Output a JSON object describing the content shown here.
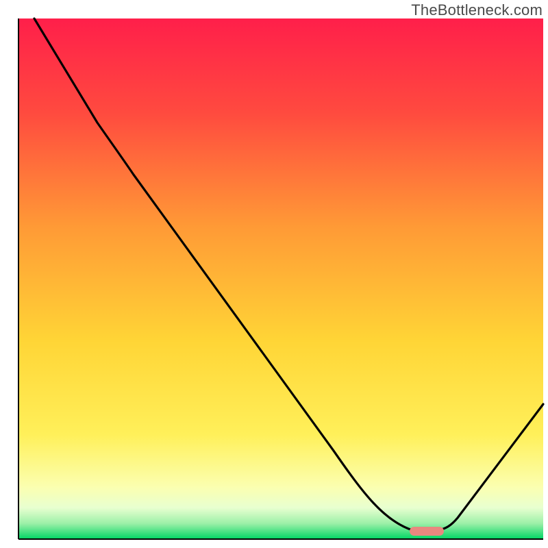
{
  "watermark": "TheBottleneck.com",
  "chart_data": {
    "type": "line",
    "title": "",
    "xlabel": "",
    "ylabel": "",
    "xlim": [
      0,
      100
    ],
    "ylim": [
      0,
      100
    ],
    "grid": false,
    "series": [
      {
        "name": "bottleneck-curve",
        "x": [
          3,
          15,
          20,
          60,
          75,
          80,
          81,
          100
        ],
        "y": [
          100,
          80,
          74,
          17,
          1.5,
          1.5,
          2,
          26
        ],
        "stroke": "#000000"
      }
    ],
    "marker": {
      "name": "optimal-range",
      "x": 77.5,
      "y": 1.5,
      "width": 6,
      "height": 1.6,
      "color": "#e9887f"
    },
    "background_gradient": {
      "top_color": "#ff1f4a",
      "mid1_color": "#ff7b3a",
      "mid2_color": "#ffd536",
      "mid3_color": "#fff680",
      "band_color": "#fdffd6",
      "bottom_color": "#00d664",
      "axis_line_color": "#000000"
    }
  }
}
